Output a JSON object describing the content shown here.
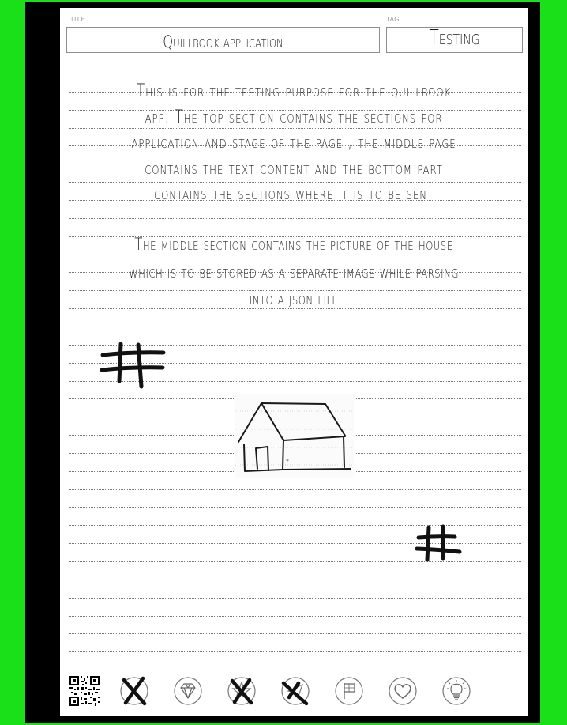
{
  "header": {
    "title_label": "TITLE",
    "title_value": "Quillbook application",
    "tag_label": "TAG",
    "tag_value": "Testing"
  },
  "content": {
    "paragraph1": [
      "This is for the testing purpose for the quillbook",
      "app. The top section contains the sections for",
      "application and stage of the page , the middle page",
      "contains the text content and the bottom part",
      "contains the sections where it is to be sent"
    ],
    "paragraph2": [
      "The middle section contains the picture of the house",
      "which is to be stored as a separate image while parsing",
      "into a json file"
    ],
    "sketches": [
      "hashtag-sketch",
      "house-sketch",
      "hashtag-sketch"
    ]
  },
  "footer": {
    "icons": [
      {
        "name": "qr-code-icon",
        "state": "visible"
      },
      {
        "name": "x-icon",
        "state": "crossed-out"
      },
      {
        "name": "diamond-icon",
        "state": "normal"
      },
      {
        "name": "star-icon",
        "state": "crossed-out"
      },
      {
        "name": "send-icon",
        "state": "crossed-out"
      },
      {
        "name": "flag-icon",
        "state": "normal"
      },
      {
        "name": "heart-icon",
        "state": "normal"
      },
      {
        "name": "lightbulb-icon",
        "state": "normal"
      }
    ]
  },
  "colors": {
    "frame": "#19e019",
    "page": "#ffffff",
    "ink": "#1c1c1c",
    "rule": "#777777"
  }
}
